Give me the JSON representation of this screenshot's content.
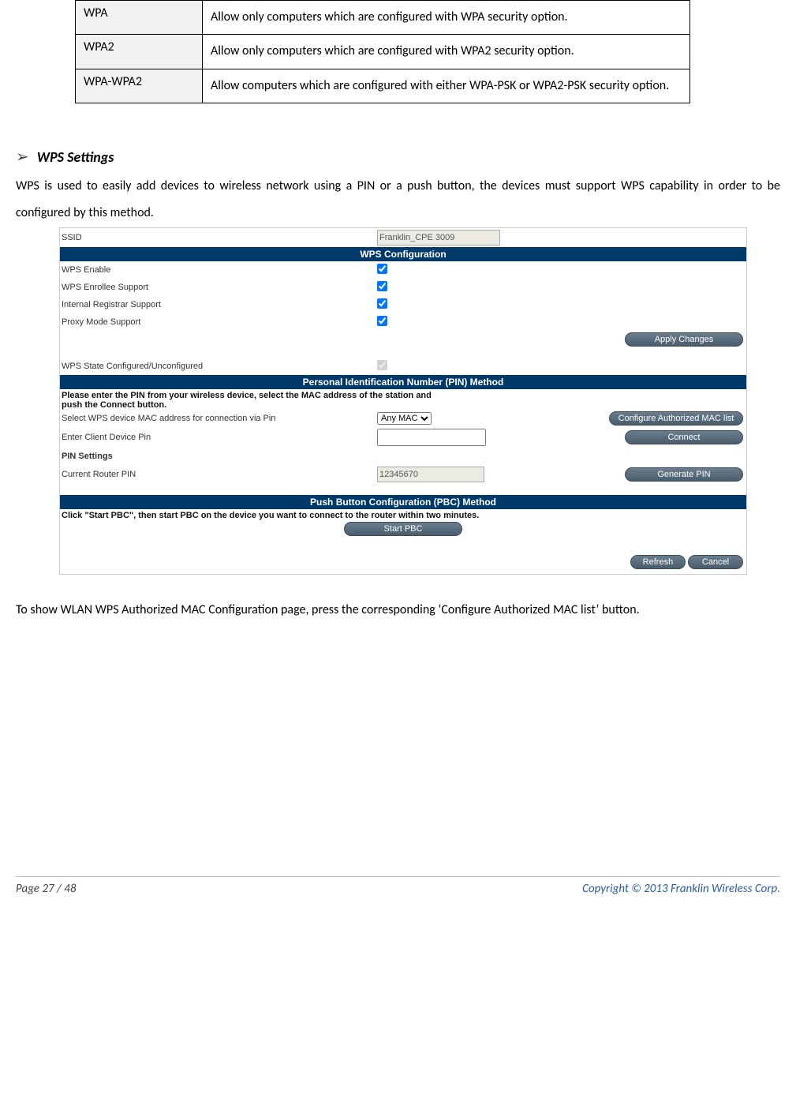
{
  "table": {
    "rows": [
      {
        "key": "WPA",
        "val": "Allow only computers which are configured with WPA security option."
      },
      {
        "key": "WPA2",
        "val": "Allow only computers which are configured with WPA2 security option."
      },
      {
        "key": "WPA-WPA2",
        "val": "Allow computers which are configured with either WPA-PSK or WPA2-PSK security option."
      }
    ]
  },
  "heading": "WPS Settings",
  "intro_text": "WPS is used to easily add devices to wireless network using a PIN or a push button, the devices must support WPS capability in order to be configured by this method.",
  "ui": {
    "ssid_label": "SSID",
    "ssid_value": "Franklin_CPE 3009",
    "bar_wps": "WPS Configuration",
    "wps_enable": "WPS Enable",
    "wps_enrollee": "WPS Enrollee Support",
    "internal_registrar": "Internal Registrar Support",
    "proxy_mode": "Proxy Mode Support",
    "apply_changes": "Apply Changes",
    "wps_state": "WPS State Configured/Unconfigured",
    "bar_pin": "Personal Identification Number (PIN) Method",
    "pin_instr": "Please enter the PIN from your wireless device, select the MAC address of the station and push the Connect button.",
    "select_mac_label": "Select WPS device MAC address for connection via Pin",
    "select_mac_option": "Any MAC",
    "configure_mac_btn": "Configure Authorized MAC list",
    "enter_pin_label": "Enter Client Device Pin",
    "connect_btn": "Connect",
    "pin_settings": "PIN Settings",
    "current_pin_label": "Current Router PIN",
    "current_pin_value": "12345670",
    "generate_pin_btn": "Generate PIN",
    "bar_pbc": "Push Button Configuration (PBC) Method",
    "pbc_instr": "Click \"Start PBC\", then start PBC on the device you want to connect to the router within two minutes.",
    "start_pbc_btn": "Start PBC",
    "refresh_btn": "Refresh",
    "cancel_btn": "Cancel"
  },
  "outro_text": "To show WLAN WPS Authorized MAC Configuration page, press the corresponding ‘Configure Authorized MAC list’ button.",
  "footer": {
    "left": "Page  27  /  48",
    "right": "Copyright © 2013   Franklin Wireless Corp."
  }
}
